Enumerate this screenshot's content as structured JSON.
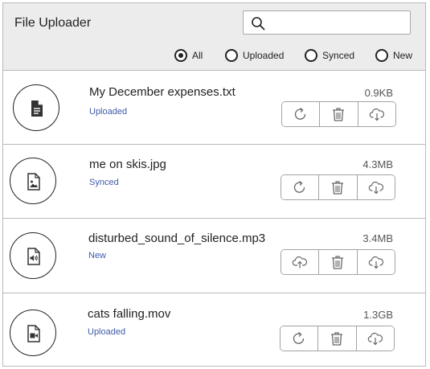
{
  "header": {
    "title": "File Uploader",
    "search": {
      "value": "",
      "placeholder": ""
    },
    "filters": [
      {
        "label": "All",
        "checked": true
      },
      {
        "label": "Uploaded",
        "checked": false
      },
      {
        "label": "Synced",
        "checked": false
      },
      {
        "label": "New",
        "checked": false
      }
    ]
  },
  "files": [
    {
      "name": "My December expenses.txt",
      "status": "Uploaded",
      "size": "0.9KB",
      "icon": "document-icon",
      "first_action_icon": "refresh-icon"
    },
    {
      "name": "me on skis.jpg",
      "status": "Synced",
      "size": "4.3MB",
      "icon": "image-icon",
      "first_action_icon": "refresh-icon"
    },
    {
      "name": "disturbed_sound_of_silence.mp3",
      "status": "New",
      "size": "3.4MB",
      "icon": "audio-file-icon",
      "first_action_icon": "cloud-upload-icon"
    },
    {
      "name": "cats falling.mov",
      "status": "Uploaded",
      "size": "1.3GB",
      "icon": "video-file-icon",
      "first_action_icon": "refresh-icon"
    }
  ],
  "actions": {
    "delete_icon": "trash-icon",
    "download_icon": "cloud-download-icon"
  }
}
